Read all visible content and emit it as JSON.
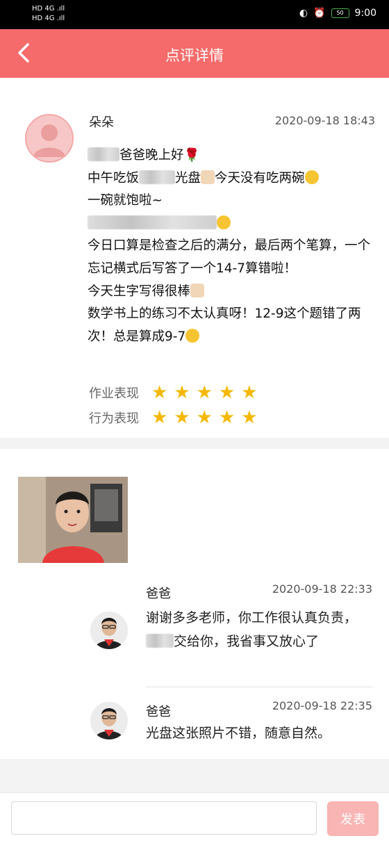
{
  "status_bar": {
    "sim1": "HD 4G .ıll",
    "sim2": "HD 4G .ıll",
    "battery": "50",
    "time": "9:00"
  },
  "header": {
    "title": "点评详情"
  },
  "post": {
    "sender": "朵朵",
    "time": "2020-09-18 18:43",
    "lines": {
      "greeting_suffix": "爸爸晚上好",
      "lunch_prefix": "中午吃饭",
      "lunch_suffix": "光盘",
      "lunch_tail": "今天没有吃两碗",
      "full": "一碗就饱啦~",
      "math_check": "今日口算是检查之后的满分，最后两个笔算，一个忘记横式后写答了一个14-7算错啦！",
      "writing": "今天生字写得很棒",
      "homework": "数学书上的练习不太认真呀！12-9这个题错了两次！总是算成9-7"
    },
    "ratings": [
      {
        "label": "作业表现",
        "stars": 5
      },
      {
        "label": "行为表现",
        "stars": 5
      }
    ]
  },
  "replies": [
    {
      "name": "爸爸",
      "time": "2020-09-18 22:33",
      "text_a": "谢谢多多老师，你工作很认真负责，",
      "text_b": "交给你，我省事又放心了"
    },
    {
      "name": "爸爸",
      "time": "2020-09-18 22:35",
      "text": "光盘这张照片不错，随意自然。"
    }
  ],
  "composer": {
    "placeholder": "",
    "send_label": "发表"
  }
}
